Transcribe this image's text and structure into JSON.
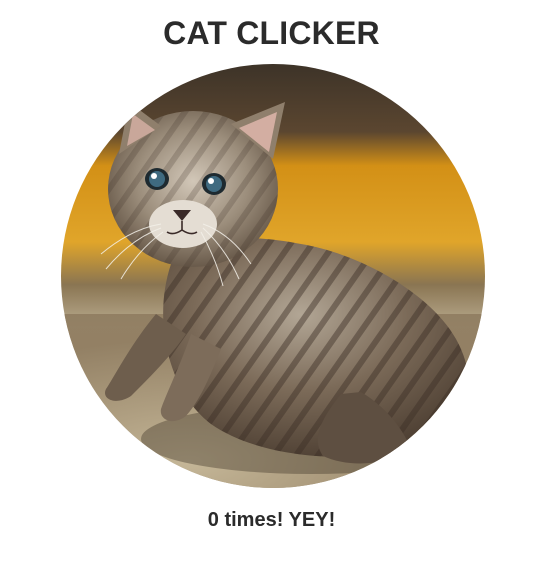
{
  "app": {
    "title": "CAT CLICKER"
  },
  "cat": {
    "image_alt": "kitten-photo",
    "click_count": 0,
    "counter_text": "0 times! YEY!"
  },
  "colors": {
    "text": "#2b2b2b",
    "background": "#ffffff",
    "photo_warm_background": "#d9971a",
    "carpet": "#b8a98c",
    "fur_dark": "#5a4a3c",
    "fur_light": "#a89a88"
  }
}
